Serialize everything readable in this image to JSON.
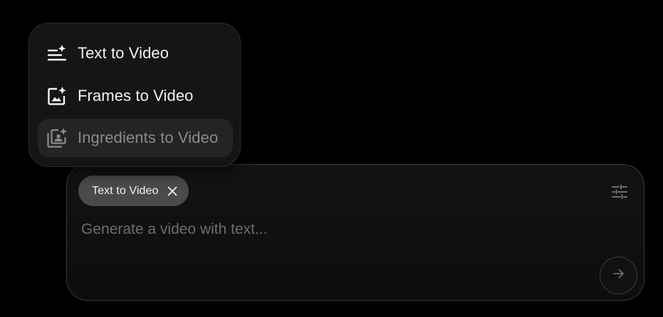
{
  "mode_menu": {
    "items": [
      {
        "label": "Text to Video",
        "icon": "text-sparkle-icon",
        "state": "normal"
      },
      {
        "label": "Frames to Video",
        "icon": "image-sparkle-icon",
        "state": "normal"
      },
      {
        "label": "Ingredients to Video",
        "icon": "photo-library-sparkle-icon",
        "state": "highlighted-disabled"
      }
    ]
  },
  "composer": {
    "selected_mode_chip": "Text to Video",
    "chip_close_icon": "close-icon",
    "settings_icon": "tune-sliders-icon",
    "prompt_placeholder": "Generate a video with text...",
    "prompt_value": "",
    "send_icon": "arrow-right-icon"
  },
  "colors": {
    "background": "#000000",
    "surface": "#151515",
    "chip": "#4a4a4a",
    "text_primary": "#f2f2f2",
    "text_muted": "#8a8a8a",
    "placeholder": "#6d6d6d",
    "border": "#3a3a3a"
  }
}
